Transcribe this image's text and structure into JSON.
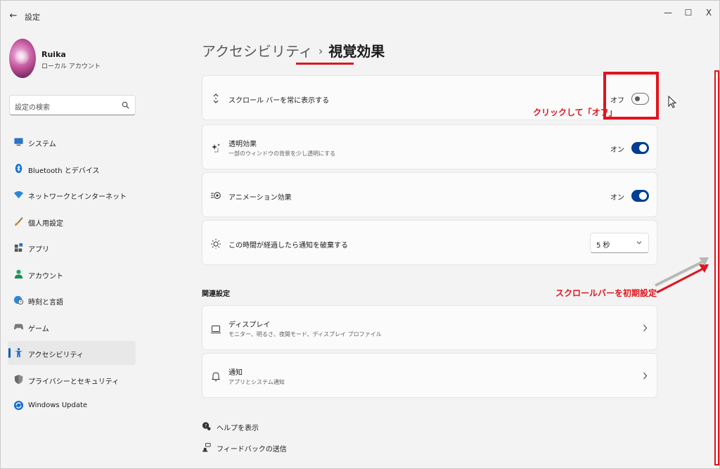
{
  "window": {
    "title": "設定",
    "controls": {
      "minimize": "—",
      "maximize": "☐",
      "close": "X"
    }
  },
  "profile": {
    "name": "Ruika",
    "account_type": "ローカル アカウント"
  },
  "search": {
    "placeholder": "設定の検索"
  },
  "sidebar": {
    "items": [
      {
        "label": "システム",
        "icon": "monitor-icon"
      },
      {
        "label": "Bluetooth とデバイス",
        "icon": "bluetooth-icon"
      },
      {
        "label": "ネットワークとインターネット",
        "icon": "wifi-icon"
      },
      {
        "label": "個人用設定",
        "icon": "brush-icon"
      },
      {
        "label": "アプリ",
        "icon": "apps-icon"
      },
      {
        "label": "アカウント",
        "icon": "person-icon"
      },
      {
        "label": "時刻と言語",
        "icon": "globe-clock-icon"
      },
      {
        "label": "ゲーム",
        "icon": "gamepad-icon"
      },
      {
        "label": "アクセシビリティ",
        "icon": "accessibility-icon",
        "active": true
      },
      {
        "label": "プライバシーとセキュリティ",
        "icon": "shield-icon"
      },
      {
        "label": "Windows Update",
        "icon": "update-icon"
      }
    ]
  },
  "breadcrumb": {
    "parent": "アクセシビリティ",
    "separator": "›",
    "current": "視覚効果"
  },
  "settings": [
    {
      "title": "スクロール バーを常に表示する",
      "icon": "scroll-arrows-icon",
      "state": "オフ",
      "toggle": false
    },
    {
      "title": "透明効果",
      "subtitle": "一部のウィンドウの背景を少し透明にする",
      "icon": "sparkle-icon",
      "state": "オン",
      "toggle": true
    },
    {
      "title": "アニメーション効果",
      "icon": "animation-icon",
      "state": "オン",
      "toggle": true
    },
    {
      "title": "この時間が経過したら通知を破棄する",
      "icon": "sun-icon",
      "select_value": "5 秒"
    }
  ],
  "related": {
    "heading": "関連設定",
    "items": [
      {
        "title": "ディスプレイ",
        "subtitle": "モニター、明るさ、夜間モード、ディスプレイ プロファイル",
        "icon": "laptop-icon"
      },
      {
        "title": "通知",
        "subtitle": "アプリとシステム通知",
        "icon": "bell-icon"
      }
    ]
  },
  "footer": {
    "help": "ヘルプを表示",
    "feedback": "フィードバックの送信"
  },
  "annotations": {
    "click_off": "クリックして「オフ」",
    "scrollbar_default": "スクロールバーを初期設定"
  },
  "colors": {
    "accent": "#005fb8",
    "toggle_on": "#003e92",
    "annotation": "#e0141e"
  }
}
